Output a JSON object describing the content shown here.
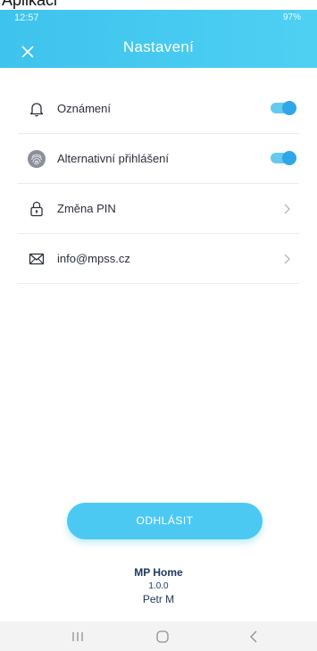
{
  "top_strip_text": "Aplikaci",
  "status_bar": {
    "time": "12:57",
    "indicators": "97%"
  },
  "header": {
    "title": "Nastavení",
    "close_icon": "close-icon",
    "color": "#3ec3ee"
  },
  "settings": {
    "items": [
      {
        "label": "Oznámení",
        "icon": "bell-icon",
        "control": "toggle",
        "enabled": true
      },
      {
        "label": "Alternativní přihlášení",
        "icon": "fingerprint-icon",
        "control": "toggle",
        "enabled": true
      },
      {
        "label": "Změna PIN",
        "icon": "lock-icon",
        "control": "chevron"
      },
      {
        "label": "info@mpss.cz",
        "icon": "mail-icon",
        "control": "chevron"
      }
    ]
  },
  "actions": {
    "logout_label": "ODHLÁSIT",
    "logout_color": "#4cc9f3"
  },
  "footer": {
    "app_name": "MP Home",
    "version": "1.0.0",
    "user": "Petr M"
  },
  "navbar": {
    "items": [
      "recent-apps-icon",
      "home-icon",
      "back-icon"
    ]
  }
}
